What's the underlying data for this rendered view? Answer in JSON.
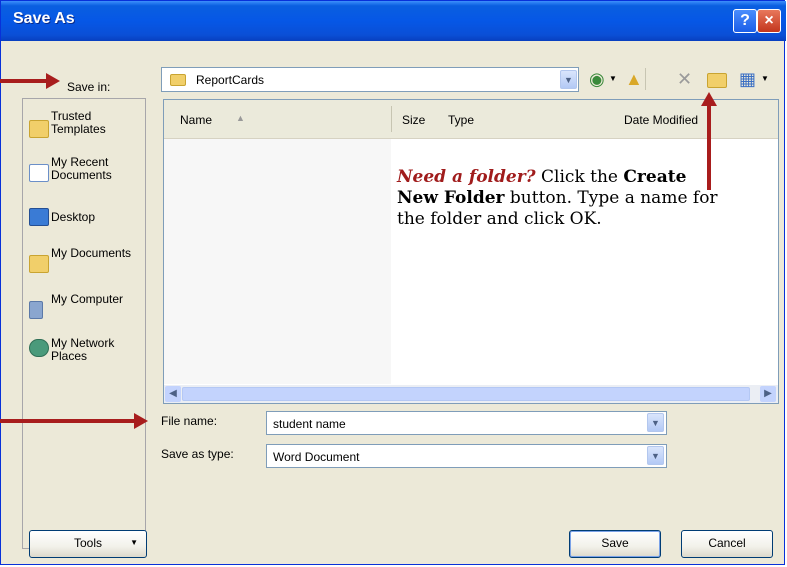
{
  "window": {
    "title": "Save As",
    "help_glyph": "?",
    "close_glyph": "×"
  },
  "toolbar": {
    "save_in_label": "Save in:",
    "location_value": "ReportCards",
    "back_icon": "back-icon",
    "up_folder_icon": "up-folder-icon",
    "delete_icon": "delete-icon",
    "new_folder_icon": "new-folder-icon",
    "views_icon": "views-icon"
  },
  "places": [
    {
      "label": "Trusted Templates",
      "icon": "folder-icon"
    },
    {
      "label": "My Recent Documents",
      "icon": "recent-documents-icon"
    },
    {
      "label": "Desktop",
      "icon": "desktop-icon"
    },
    {
      "label": "My Documents",
      "icon": "my-documents-icon"
    },
    {
      "label": "My Computer",
      "icon": "computer-icon"
    },
    {
      "label": "My Network Places",
      "icon": "network-icon"
    }
  ],
  "file_list": {
    "columns": [
      "Name",
      "Size",
      "Type",
      "Date Modified"
    ]
  },
  "note": {
    "lead": "Need a folder?",
    "part1": " Click the ",
    "bold": "Create New Folder",
    "part2": " button. Type a name for the folder and click OK."
  },
  "fields": {
    "file_name_label": "File name:",
    "file_name_value": "student name",
    "save_as_type_label": "Save as type:",
    "save_as_type_value": "Word Document"
  },
  "buttons": {
    "tools": "Tools",
    "save": "Save",
    "cancel": "Cancel"
  },
  "colors": {
    "annotation_arrow": "#a81d1d",
    "title_bar": "#0657e6"
  }
}
